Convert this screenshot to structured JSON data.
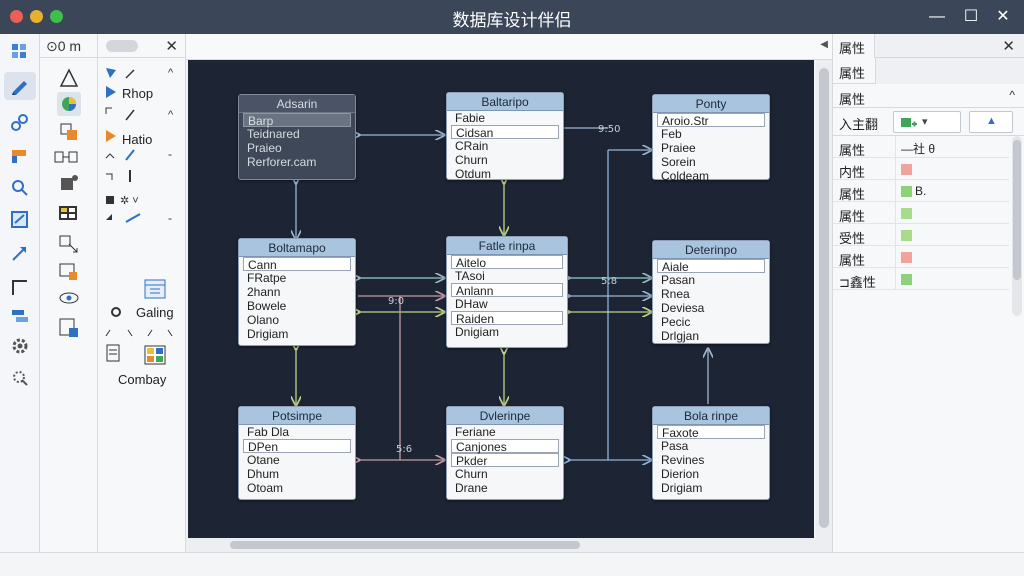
{
  "window": {
    "title": "数据库设计伴侣",
    "controls": {
      "minimize": "—",
      "maximize": "☐",
      "close": "✕"
    }
  },
  "panel1": {
    "header": "⊙0 m"
  },
  "panel2": {
    "close": "✕",
    "items": [
      {
        "label": "Rhop"
      },
      {
        "label": "Hatio"
      },
      {
        "label": "Galing"
      },
      {
        "label": "Combay"
      }
    ]
  },
  "canvas": {
    "labels": {
      "a": "9:50",
      "b": "5:8",
      "c": "9:0",
      "d": "5:6"
    },
    "entities": [
      {
        "title": "Adsarin",
        "rows": [
          "Barp",
          "Teidnared",
          "Praieo",
          "Rerforer.cam"
        ]
      },
      {
        "title": "Baltaripo",
        "rows": [
          "Fabie",
          "Cidsan",
          "CRain",
          "Churn",
          "Otdum"
        ]
      },
      {
        "title": "Ponty",
        "rows": [
          "Aroio.Str",
          "Feb",
          "Praiee",
          "Sorein",
          "Coldeam"
        ]
      },
      {
        "title": "Boltamapo",
        "rows": [
          "Cann",
          "FRatpe",
          "2hann",
          "Bowele",
          "Olano",
          "Drigiam"
        ]
      },
      {
        "title": "Fatle rinpa",
        "rows": [
          "Aitelo",
          "TAsoi",
          "Anlann",
          "DHaw",
          "Raiden",
          "Dnigiam"
        ]
      },
      {
        "title": "Deterinpo",
        "rows": [
          "Aiale",
          "Pasan",
          "Rnea",
          "Deviesa",
          "Pecic",
          "Drlgjan"
        ]
      },
      {
        "title": "Potsimpe",
        "rows": [
          "Fab Dla",
          "DPen",
          "Otane",
          "Dhum",
          "Otoam"
        ]
      },
      {
        "title": "Dvlerinpe",
        "rows": [
          "Feriane",
          "Canjones",
          "Pkder",
          "Churn",
          "Drane"
        ]
      },
      {
        "title": "Bola rinpe",
        "rows": [
          "Faxote",
          "Pasa",
          "Revines",
          "Dierion",
          "Drigiam"
        ]
      }
    ]
  },
  "properties": {
    "tab": "属性",
    "close": "✕",
    "subtab": "属性",
    "section": "属性",
    "section_caret": "^",
    "input_label": "入主翻",
    "up_caret": "▲",
    "dropdown": "▾",
    "rows": [
      {
        "key": "属性",
        "value": "—社 θ",
        "color": ""
      },
      {
        "key": "内性",
        "value": "",
        "color": "#f0a39a"
      },
      {
        "key": "属性",
        "value": "B.",
        "color": "#8fd07a"
      },
      {
        "key": "属性",
        "value": "",
        "color": "#a6dc8a"
      },
      {
        "key": "受性",
        "value": "",
        "color": "#a6dc8a"
      },
      {
        "key": "属性",
        "value": "",
        "color": "#f0a39a"
      },
      {
        "key": "⊐鑫性",
        "value": "",
        "color": "#8fd07a"
      }
    ]
  },
  "colors": {
    "titlebar": "#3b4658",
    "canvas": "#1d2535",
    "entity_header": "#a9c4df",
    "connector": "#8aa6c4",
    "accent_green": "#bfd07e"
  }
}
